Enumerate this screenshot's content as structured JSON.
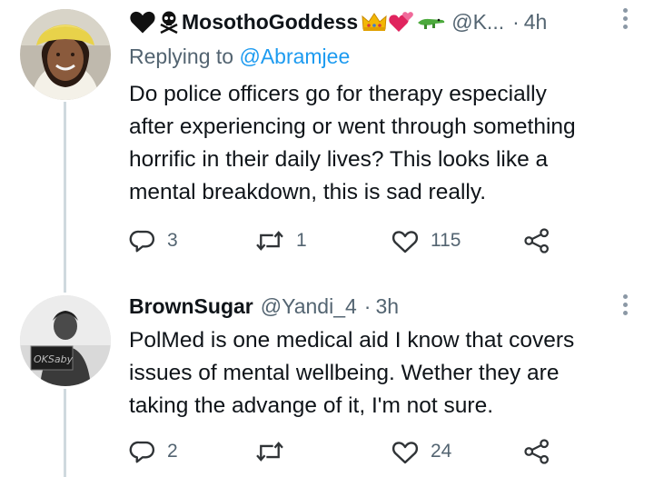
{
  "tweet1": {
    "name": "MosothoGoddess",
    "handle": "@K...",
    "dot": "·",
    "time": "4h",
    "replying_prefix": "Replying to ",
    "replying_to": "@Abramjee",
    "text_lines": [
      "Do police officers go for therapy especially",
      "after experiencing or went through something",
      "horrific in their daily lives? This looks like a",
      "mental breakdown, this is sad really."
    ],
    "stats": {
      "replies": "3",
      "retweets": "1",
      "likes": "115"
    }
  },
  "tweet2": {
    "name": "BrownSugar",
    "handle": "@Yandi_4",
    "dot": "·",
    "time": "3h",
    "text_lines": [
      "PolMed is one medical aid I know that covers",
      "issues of mental wellbeing. Wether they are",
      "taking the advange of it, I'm  not sure."
    ],
    "stats": {
      "replies": "2",
      "retweets": "",
      "likes": "24"
    },
    "avatar_sign_text": "OKSaby"
  },
  "colors": {
    "text": "#0f1419",
    "muted": "#536471",
    "link": "#1d9bf0",
    "thread_line": "#cfd9de"
  }
}
